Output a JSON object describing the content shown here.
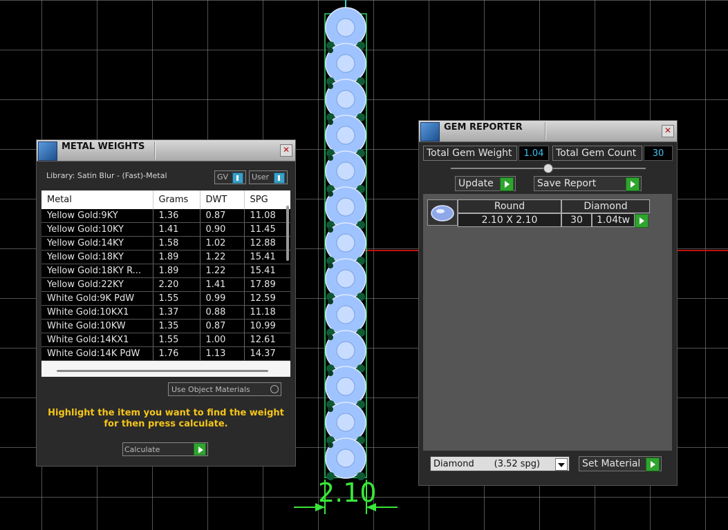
{
  "viewport": {
    "dimension_label": "2.10",
    "grid_color": "#969696",
    "axis_color": "#c01010",
    "dimension_color": "#39e639",
    "gem_color": "#9fc3ff",
    "prong_color": "#0f5a35"
  },
  "metal_weights": {
    "title": "METAL WEIGHTS",
    "close": "✕",
    "library": "Library: Satin Blur - (Fast)-Metal",
    "gv_label": "GV",
    "user_label": "User",
    "columns": [
      "Metal",
      "Grams",
      "DWT",
      "SPG"
    ],
    "rows": [
      [
        "Yellow Gold:9KY",
        "1.36",
        "0.87",
        "11.08"
      ],
      [
        "Yellow Gold:10KY",
        "1.41",
        "0.90",
        "11.45"
      ],
      [
        "Yellow Gold:14KY",
        "1.58",
        "1.02",
        "12.88"
      ],
      [
        "Yellow Gold:18KY",
        "1.89",
        "1.22",
        "15.41"
      ],
      [
        "Yellow Gold:18KY R...",
        "1.89",
        "1.22",
        "15.41"
      ],
      [
        "Yellow Gold:22KY",
        "2.20",
        "1.41",
        "17.89"
      ],
      [
        "White Gold:9K PdW",
        "1.55",
        "0.99",
        "12.59"
      ],
      [
        "White Gold:10KX1",
        "1.37",
        "0.88",
        "11.18"
      ],
      [
        "White Gold:10KW",
        "1.35",
        "0.87",
        "10.99"
      ],
      [
        "White Gold:14KX1",
        "1.55",
        "1.00",
        "12.61"
      ],
      [
        "White Gold:14K PdW",
        "1.76",
        "1.13",
        "14.37"
      ]
    ],
    "use_object_materials": "Use Object Materials",
    "instruction_line1": "Highlight the item you want to find the weight",
    "instruction_line2": "for then press calculate.",
    "calculate_label": "Calculate",
    "instruction_color": "#f5c518"
  },
  "gem_reporter": {
    "title": "GEM REPORTER",
    "close": "✕",
    "total_weight_label": "Total Gem Weight",
    "total_weight_value": "1.04",
    "total_count_label": "Total Gem Count",
    "total_count_value": "30",
    "update_label": "Update",
    "save_report_label": "Save Report",
    "table": {
      "shape": "Round",
      "material": "Diamond",
      "size": "2.10 X 2.10",
      "count": "30",
      "weight": "1.04tw"
    },
    "material_select": "Diamond       (3.52 spg)",
    "set_material_label": "Set Material",
    "value_color": "#3fc2f5",
    "button_green": "#2fa52f"
  }
}
